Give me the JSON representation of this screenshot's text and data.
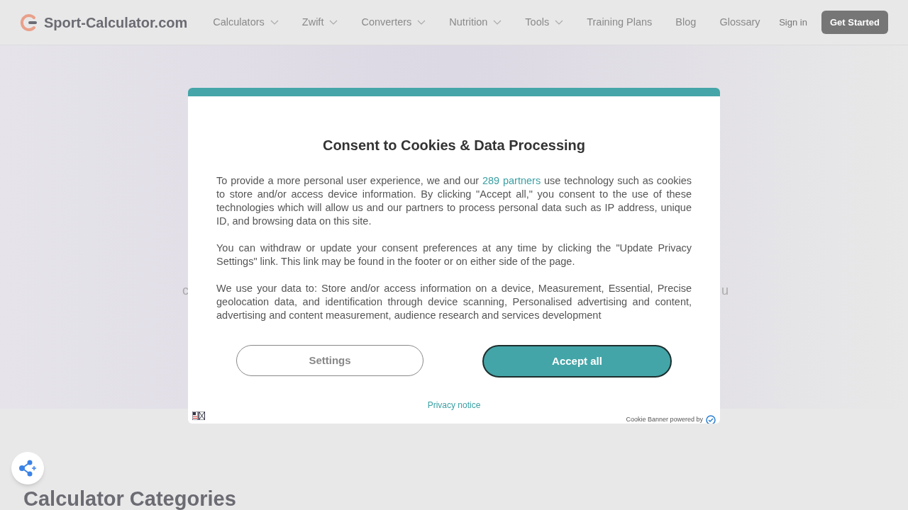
{
  "header": {
    "logo": "Sport-Calculator.com",
    "nav": [
      {
        "label": "Calculators",
        "dropdown": true
      },
      {
        "label": "Zwift",
        "dropdown": true
      },
      {
        "label": "Converters",
        "dropdown": true
      },
      {
        "label": "Nutrition",
        "dropdown": true
      },
      {
        "label": "Tools",
        "dropdown": true
      },
      {
        "label": "Training Plans",
        "dropdown": false
      },
      {
        "label": "Blog",
        "dropdown": false
      },
      {
        "label": "Glossary",
        "dropdown": false
      }
    ],
    "sign_in": "Sign in",
    "cta": "Get Started"
  },
  "hero": {
    "left_fragment": "c",
    "right_fragment": "u"
  },
  "section_heading": "Calculator Categories",
  "consent_dialog": {
    "title": "Consent to Cookies & Data Processing",
    "paragraphs": [
      {
        "before": "To provide a more personal user experience, we and our ",
        "link": "289 partners",
        "after": " use technology such as cookies to store and/or access device information. By clicking \"Accept all,\" you consent to the use of these technologies which will allow us and our partners to process personal data such as IP address, unique ID, and browsing data on this site."
      },
      {
        "before": "You can withdraw or update your consent preferences at any time by clicking the \"Update Privacy Settings\" link. This link may be found in the footer or on either side of the page."
      },
      {
        "before": "We use your data to: Store and/or access information on a device, Measurement, Essential, Precise geolocation data, and identification through device scanning, Personalised advertising and content, advertising and content measurement, audience research and services development"
      }
    ],
    "buttons": [
      {
        "label": "Settings",
        "kind": "secondary"
      },
      {
        "label": "Accept all",
        "kind": "primary"
      }
    ],
    "privacy_link": "Privacy notice",
    "powered_by": "Cookie Banner powered by"
  }
}
